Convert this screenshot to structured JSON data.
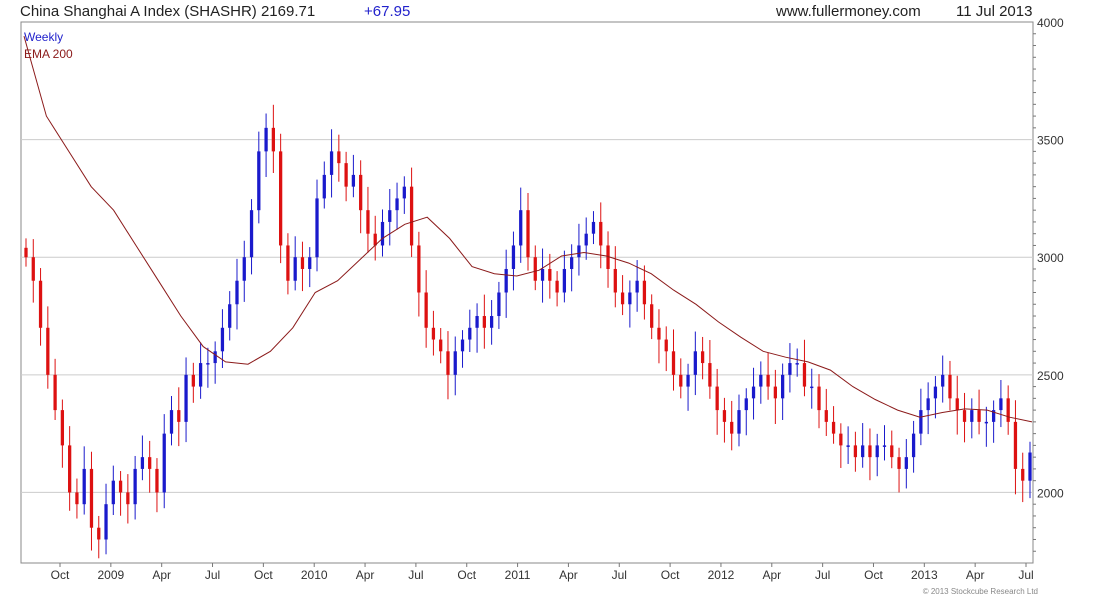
{
  "header": {
    "title": "China Shanghai A Index (SHASHR) 2169.71",
    "change": "+67.95",
    "site": "www.fullermoney.com",
    "date": "11 Jul 2013"
  },
  "legend": {
    "weekly": "Weekly",
    "ema": "EMA 200"
  },
  "copyright": "© 2013 Stockcube Research Ltd",
  "colors": {
    "up": "#1a1acc",
    "down": "#dd1111",
    "ema": "#8b1a1a",
    "grid": "#cccccc",
    "axis": "#555555"
  },
  "chart_data": {
    "type": "candlestick",
    "ylim": [
      1700,
      4000
    ],
    "y_ticks": [
      2000,
      2500,
      3000,
      3500,
      4000
    ],
    "x_ticks": [
      "Oct",
      "2009",
      "Apr",
      "Jul",
      "Oct",
      "2010",
      "Apr",
      "Jul",
      "Oct",
      "2011",
      "Apr",
      "Jul",
      "Oct",
      "2012",
      "Apr",
      "Jul",
      "Oct",
      "2013",
      "Apr",
      "Jul"
    ],
    "series": [
      {
        "name": "Weekly",
        "style": "candlestick",
        "values": [
          3000,
          2900,
          2700,
          2500,
          2350,
          2200,
          2000,
          1950,
          2100,
          1850,
          1800,
          1950,
          2050,
          2000,
          1950,
          2100,
          2150,
          2100,
          2000,
          2250,
          2350,
          2300,
          2500,
          2450,
          2550,
          2550,
          2600,
          2700,
          2800,
          2900,
          3000,
          3200,
          3450,
          3550,
          3450,
          3050,
          2900,
          3000,
          2950,
          3000,
          3250,
          3350,
          3450,
          3400,
          3300,
          3350,
          3200,
          3100,
          3050,
          3150,
          3200,
          3250,
          3300,
          3050,
          2850,
          2700,
          2650,
          2600,
          2500,
          2600,
          2650,
          2700,
          2750,
          2700,
          2750,
          2850,
          2950,
          3050,
          3200,
          3000,
          2900,
          2950,
          2900,
          2850,
          2950,
          3000,
          3050,
          3100,
          3150,
          3050,
          2950,
          2850,
          2800,
          2850,
          2900,
          2800,
          2700,
          2650,
          2600,
          2500,
          2450,
          2500,
          2600,
          2550,
          2450,
          2350,
          2300,
          2250,
          2350,
          2400,
          2450,
          2500,
          2450,
          2400,
          2500,
          2550,
          2550,
          2450,
          2450,
          2350,
          2300,
          2250,
          2200,
          2200,
          2150,
          2200,
          2150,
          2200,
          2200,
          2150,
          2100,
          2150,
          2250,
          2350,
          2400,
          2450,
          2500,
          2400,
          2350,
          2300,
          2350,
          2300,
          2300,
          2350,
          2400,
          2300,
          2100,
          2050,
          2169.71
        ]
      },
      {
        "name": "EMA 200",
        "style": "line",
        "values": [
          3940,
          3600,
          3450,
          3300,
          3200,
          3050,
          2900,
          2750,
          2620,
          2555,
          2545,
          2600,
          2700,
          2850,
          2900,
          2990,
          3080,
          3140,
          3170,
          3080,
          2960,
          2930,
          2920,
          2945,
          3005,
          3020,
          3005,
          2975,
          2930,
          2860,
          2800,
          2725,
          2660,
          2600,
          2575,
          2555,
          2520,
          2450,
          2395,
          2350,
          2320,
          2340,
          2355,
          2350,
          2320,
          2300
        ]
      }
    ]
  }
}
